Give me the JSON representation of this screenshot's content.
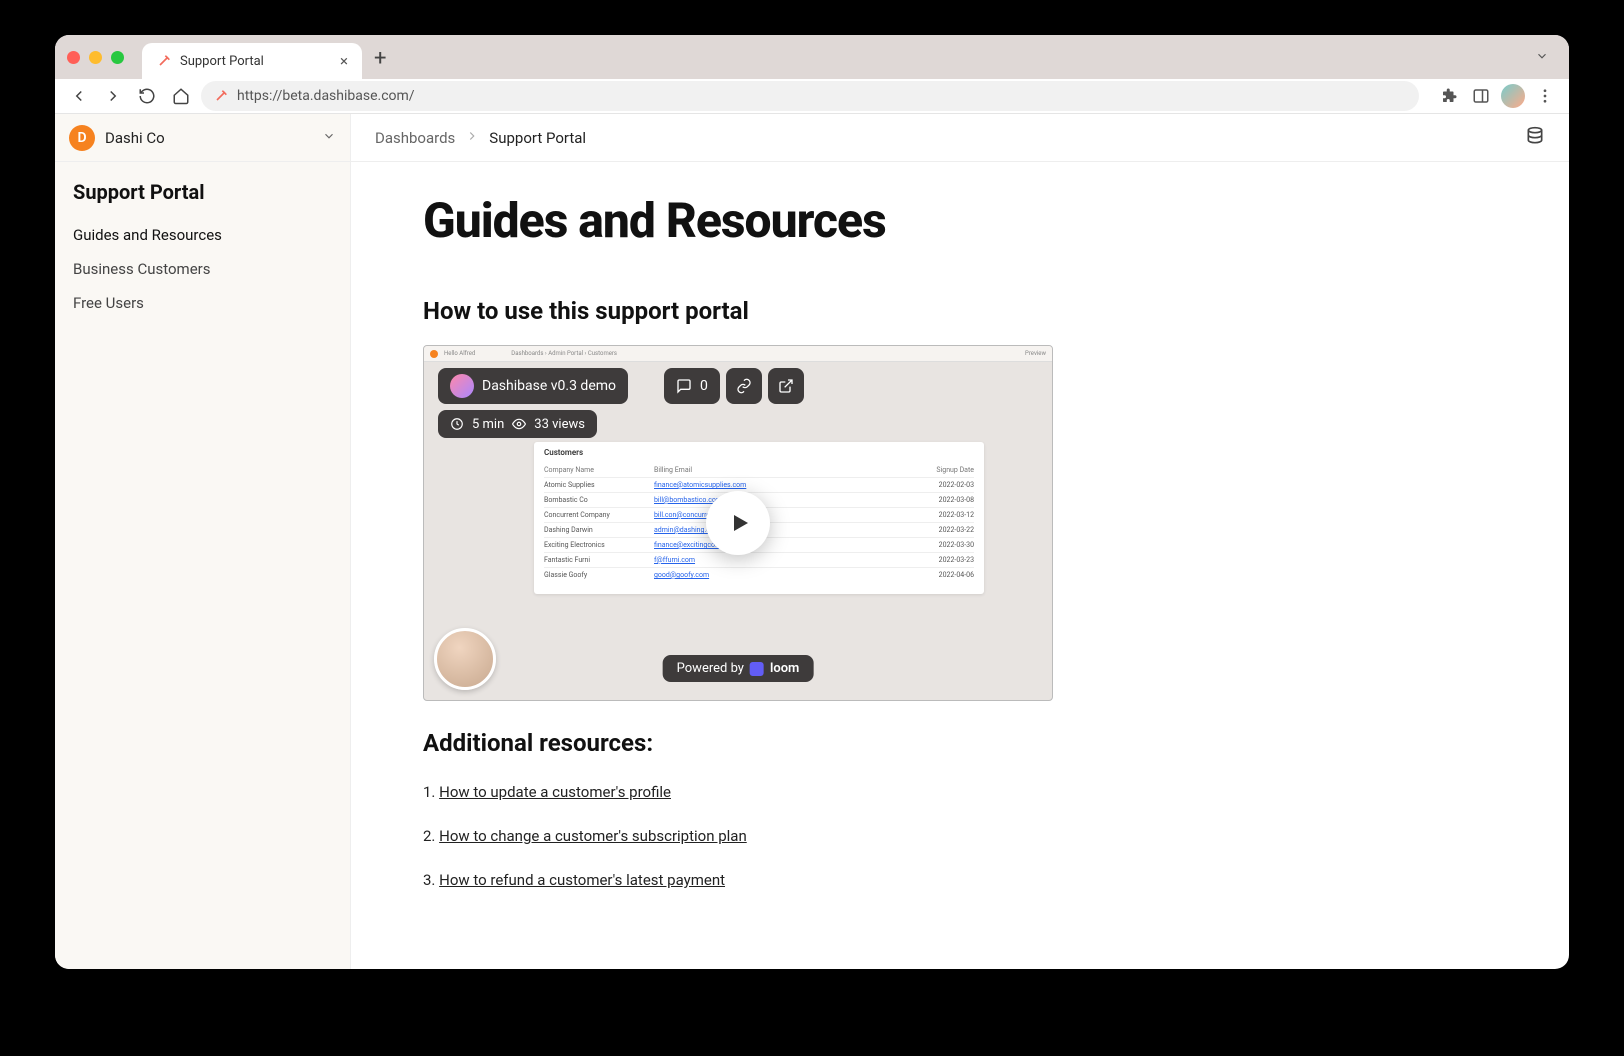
{
  "browser": {
    "tab_title": "Support Portal",
    "url": "https://beta.dashibase.com/"
  },
  "org": {
    "initial": "D",
    "name": "Dashi Co"
  },
  "sidebar": {
    "title": "Support Portal",
    "items": [
      {
        "label": "Guides and Resources"
      },
      {
        "label": "Business Customers"
      },
      {
        "label": "Free Users"
      }
    ]
  },
  "breadcrumb": {
    "root": "Dashboards",
    "current": "Support Portal"
  },
  "page": {
    "h1": "Guides and Resources",
    "h2_howto": "How to use this support portal",
    "h2_resources": "Additional resources:",
    "resources": [
      {
        "n": "1.",
        "label": "How to update a customer's profile"
      },
      {
        "n": "2.",
        "label": "How to change a customer's subscription plan"
      },
      {
        "n": "3.",
        "label": "How to refund a customer's latest payment"
      }
    ]
  },
  "video": {
    "title": "Dashibase v0.3 demo",
    "comments": "0",
    "duration": "5 min",
    "views": "33 views",
    "powered_by": "Powered by",
    "powered_brand": "loom",
    "preview_label": "Preview",
    "header_crumbs": "Dashboards  ›  Admin Portal  ›  Customers",
    "table": {
      "title": "Customers",
      "cols": [
        "Company Name",
        "Billing Email",
        "Signup Date"
      ],
      "rows": [
        [
          "Atomic Supplies",
          "finance@atomicsupplies.com",
          "2022-02-03"
        ],
        [
          "Bombastic Co",
          "bill@bombastico.com",
          "2022-03-08"
        ],
        [
          "Concurrent Company",
          "bill.con@concurrent.com",
          "2022-03-12"
        ],
        [
          "Dashing Darwin",
          "admin@dashing.com",
          "2022-03-22"
        ],
        [
          "Exciting Electronics",
          "finance@excitingco.com",
          "2022-03-30"
        ],
        [
          "Fantastic Furni",
          "f@ffurni.com",
          "2022-03-23"
        ],
        [
          "Glassie Goofy",
          "good@goofy.com",
          "2022-04-06"
        ]
      ]
    }
  }
}
